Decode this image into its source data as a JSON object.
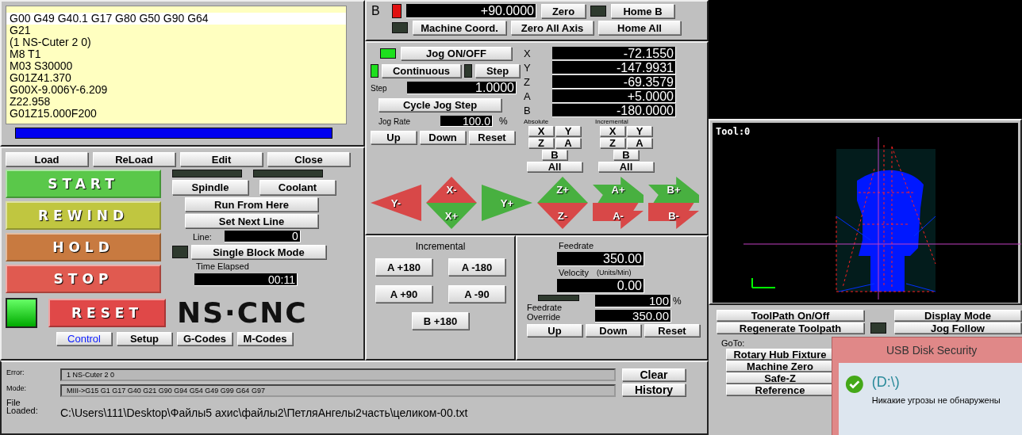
{
  "gcode": {
    "lines": [
      {
        "text": "G00 G49 G40.1 G17 G80 G50 G90 G64",
        "selected": true
      },
      {
        "text": "G21",
        "selected": false
      },
      {
        "text": "(1 NS-Cuter 2  0)",
        "selected": false
      },
      {
        "text": "M8 T1",
        "selected": false
      },
      {
        "text": "M03 S30000",
        "selected": false
      },
      {
        "text": "G01Z41.370",
        "selected": false
      },
      {
        "text": "G00X-9.006Y-6.209",
        "selected": false
      },
      {
        "text": "Z22.958",
        "selected": false
      },
      {
        "text": "G01Z15.000F200",
        "selected": false
      }
    ],
    "progress": {
      "level": 1
    }
  },
  "file_buttons": [
    "Load",
    "ReLoad",
    "Edit",
    "Close"
  ],
  "cycle_buttons": [
    {
      "label": "START",
      "color": "#5ac84a"
    },
    {
      "label": "REWIND",
      "color": "#c0c640"
    },
    {
      "label": "HOLD",
      "color": "#c87a40"
    },
    {
      "label": "STOP",
      "color": "#e05a50"
    }
  ],
  "reset": {
    "label": "RESET",
    "led_on": true
  },
  "spindle": {
    "label": "Spindle",
    "on": false
  },
  "coolant": {
    "label": "Coolant",
    "on": false
  },
  "run_from_here": "Run From Here",
  "set_next_line": "Set Next Line",
  "line": {
    "label": "Line:",
    "value": "0"
  },
  "single_block": {
    "label": "Single Block Mode",
    "on": false
  },
  "time": {
    "label": "Time Elapsed",
    "value": "00:11"
  },
  "logo": "NS·CNC",
  "tabs": [
    {
      "label": "Control",
      "selected": true
    },
    {
      "label": "Setup",
      "selected": false
    },
    {
      "label": "G-Codes",
      "selected": false
    },
    {
      "label": "M-Codes",
      "selected": false
    }
  ],
  "dro": {
    "axis": "B",
    "limit_on": true,
    "value": "+90.0000",
    "zero": "Zero",
    "home": "Home B",
    "home_on": false,
    "machine_coord": {
      "label": "Machine Coord.",
      "on": false
    },
    "zero_all": "Zero All Axis",
    "home_all": "Home All"
  },
  "jog": {
    "toggle": {
      "label": "Jog ON/OFF",
      "on": true
    },
    "modes": [
      {
        "label": "Continuous",
        "selected": true
      },
      {
        "label": "Step",
        "selected": false
      }
    ],
    "step": {
      "label": "Step",
      "value": "1.0000"
    },
    "cycle": "Cycle Jog Step",
    "rate": {
      "label": "Jog Rate",
      "value": "100.0",
      "unit": "%"
    },
    "rate_buttons": [
      "Up",
      "Down",
      "Reset"
    ],
    "positions": [
      {
        "axis": "X",
        "value": "-72.1550"
      },
      {
        "axis": "Y",
        "value": "-147.9931"
      },
      {
        "axis": "Z",
        "value": "-69.3579"
      },
      {
        "axis": "A",
        "value": "+5.0000"
      },
      {
        "axis": "B",
        "value": "-180.0000"
      }
    ],
    "axis_groups": [
      {
        "title": "Absolute",
        "buttons": [
          "X",
          "Y",
          "Z",
          "A",
          "B",
          "All"
        ]
      },
      {
        "title": "Incremental",
        "buttons": [
          "X",
          "Y",
          "Z",
          "A",
          "B",
          "All"
        ]
      }
    ],
    "arrow_groups": [
      [
        {
          "label": "Y-",
          "kind": "left",
          "color": "#d84848"
        }
      ],
      [
        {
          "label": "X-",
          "kind": "up",
          "color": "#d84848"
        },
        {
          "label": "X+",
          "kind": "down",
          "color": "#48b040"
        }
      ],
      [
        {
          "label": "Y+",
          "kind": "right",
          "color": "#48b040"
        }
      ],
      [
        {
          "label": "Z+",
          "kind": "up",
          "color": "#48b040"
        },
        {
          "label": "Z-",
          "kind": "down",
          "color": "#d84848"
        }
      ],
      [
        {
          "label": "A+",
          "kind": "curve-up",
          "color": "#48b040"
        },
        {
          "label": "A-",
          "kind": "curve-down",
          "color": "#d84848"
        }
      ],
      [
        {
          "label": "B+",
          "kind": "curve-up",
          "color": "#48b040"
        },
        {
          "label": "B-",
          "kind": "curve-down",
          "color": "#d84848"
        }
      ]
    ]
  },
  "incremental": {
    "title": "Incremental",
    "buttons": [
      "A +180",
      "A -180",
      "A +90",
      "A -90",
      "B +180"
    ]
  },
  "feed": {
    "label": "Feedrate",
    "value": "350.00",
    "velocity_label": "Velocity",
    "velocity_units": "(Units/Min)",
    "velocity": "0.00",
    "override_on": false,
    "override_label": "Feedrate Override",
    "override_percent": "100",
    "percent_unit": "%",
    "override_value": "350.00",
    "buttons": [
      "Up",
      "Down",
      "Reset"
    ]
  },
  "toolpath": {
    "tool_label": "Tool:0",
    "buttons": [
      "ToolPath On/Off",
      "Display Mode",
      "Regenerate Toolpath",
      "Jog Follow"
    ],
    "jog_follow_on": false
  },
  "goto": {
    "label": "GoTo:",
    "buttons": [
      "Rotary Hub Fixture",
      "Machine Zero",
      "Safe-Z",
      "Reference"
    ]
  },
  "status": {
    "error_label": "Error:",
    "error": "1 NS-Cuter 2  0",
    "mode_label": "Mode:",
    "mode": "MIII->G15  G1 G17 G40 G21 G90 G94 G54 G49 G99 G64 G97",
    "file_label": "File Loaded:",
    "file": "C:\\Users\\111\\Desktop\\Файлы5 ахис\\файлы2\\ПетляАнгелы2часть\\целиком-00.txt",
    "buttons": [
      "Clear",
      "History"
    ]
  },
  "popup": {
    "title": "USB Disk Security",
    "drive": "(D:\\)",
    "message": "Никакие угрозы не обнаружены"
  }
}
